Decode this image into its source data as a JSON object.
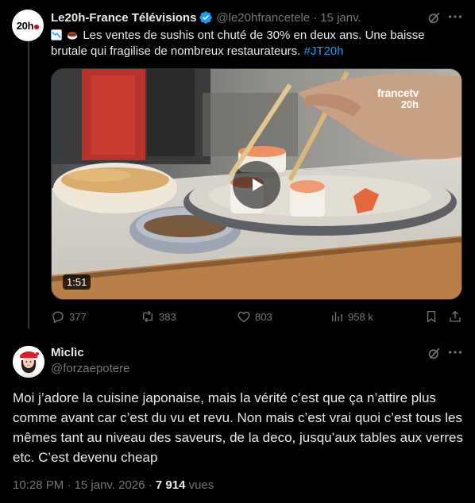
{
  "tweet": {
    "author_name": "Le20h-France Télévisions",
    "author_handle": "@le20hfrancetele",
    "separator": "·",
    "date": "15 janv.",
    "avatar_logo_text": "20h",
    "text_main": "Les ventes de sushis ont chuté de 30% en deux ans. Une baisse brutale qui fragilise de nombreux restaurateurs.",
    "hashtag": "#JT20h",
    "emojis": [
      "chart-decreasing-emoji",
      "sushi-emoji"
    ],
    "video": {
      "duration": "1:51",
      "watermark_brand": "france",
      "watermark_brand_suffix": "tv",
      "watermark_channel": "20h"
    },
    "stats": {
      "replies": "377",
      "reposts": "383",
      "likes": "803",
      "views": "958 k"
    }
  },
  "reply": {
    "author_name": "Mìclìc",
    "author_handle": "@forzaepotere",
    "text": "Moi j’adore la cuisine japonaise, mais la vérité c’est que ça n’attire plus comme avant car c’est du vu et revu. Non mais c’est vrai quoi c’est tous les mêmes tant au niveau des saveurs, de la deco, jusqu’aux tables aux verres etc. C’est devenu cheap",
    "time": "10:28 PM",
    "separator": "·",
    "date": "15 janv. 2026",
    "separator2": "·",
    "views_count": "7 914",
    "views_label": "vues"
  },
  "colors": {
    "background": "#000000",
    "text": "#e7e9ea",
    "muted": "#71767b",
    "accent": "#1d9bf0",
    "verified": "#1d9bf0"
  },
  "icons": [
    "verified-badge-icon",
    "grok-icon",
    "more-icon",
    "reply-icon",
    "repost-icon",
    "like-icon",
    "views-icon",
    "bookmark-icon",
    "share-icon",
    "play-icon"
  ]
}
